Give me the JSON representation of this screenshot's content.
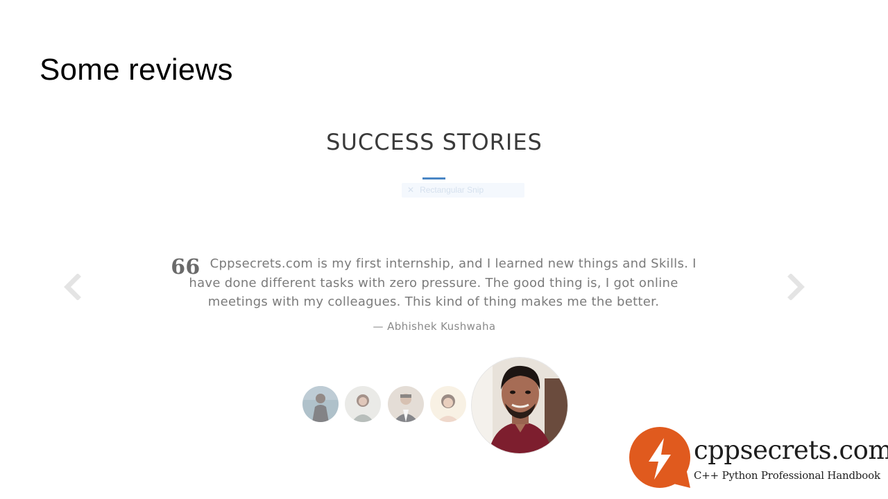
{
  "slide": {
    "title": "Some reviews"
  },
  "testimonials": {
    "heading": "SUCCESS STORIES",
    "ghost_overlay_text": "Rectangular Snip",
    "quote": "Cppsecrets.com is my first internship, and I learned new things and Skills. I have done different tasks with zero pressure. The good thing is, I got online meetings with my colleagues. This kind of thing makes me the better.",
    "author": "— Abhishek Kushwaha",
    "prev_icon": "chevron-left-icon",
    "next_icon": "chevron-right-icon",
    "quote_icon": "quote-icon",
    "quote_glyph": "66",
    "accent_color": "#4a86c5"
  },
  "brand": {
    "name": "cppsecrets.com",
    "tagline": "C++ Python Professional Handbook",
    "logo_icon": "lightning-bolt-icon",
    "logo_color": "#e05a1e"
  }
}
